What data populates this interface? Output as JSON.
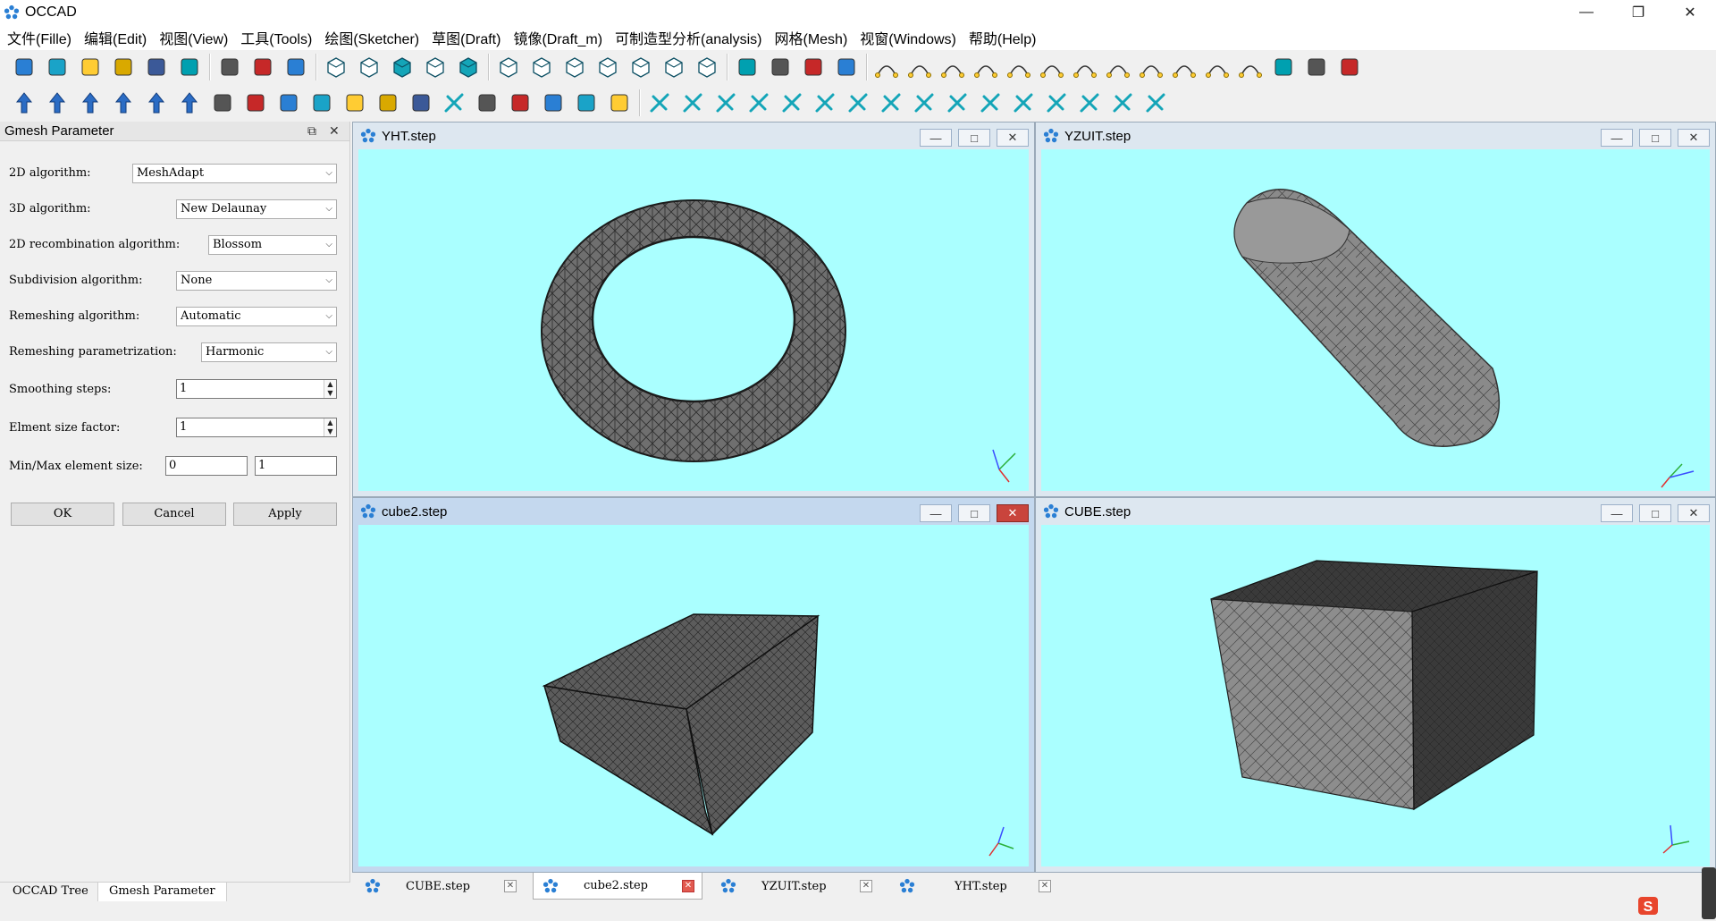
{
  "app": {
    "title": "OCCAD",
    "accent": "#2a7fd4",
    "viewport_bg": "#aaffff"
  },
  "menu": [
    "文件(Fille)",
    "编辑(Edit)",
    "视图(View)",
    "工具(Tools)",
    "绘图(Sketcher)",
    "草图(Draft)",
    "镜像(Draft_m)",
    "可制造型分析(analysis)",
    "网格(Mesh)",
    "视窗(Windows)",
    "帮助(Help)"
  ],
  "toolbar1_icons": [
    "new-file-icon",
    "open-file-icon",
    "save-icon",
    "cut-icon",
    "copy-icon",
    "paste-icon",
    "zoom-fit-icon",
    "zoom-icon",
    "no-select-icon",
    "shaded-view-icon",
    "wireframe-view-icon",
    "hidden-line-icon",
    "points-view-icon",
    "solid-cube-icon",
    "view-front-icon",
    "view-top-icon",
    "view-right-icon",
    "view-left-icon",
    "view-iso-icon",
    "view-back-icon",
    "view-bottom-icon",
    "ruler-icon",
    "pointer-icon",
    "palette-icon",
    "screenshot-icon",
    "line-icon",
    "polyline-icon",
    "circle-icon",
    "arc-icon",
    "spline-icon",
    "polygon-icon",
    "rectangle-icon",
    "text-icon",
    "dimension-icon",
    "bezier-icon",
    "point-icon",
    "s-curve-icon",
    "extrude-icon",
    "hatch-icon",
    "clipboard-tool-icon"
  ],
  "toolbar2_icons": [
    "move-icon",
    "rotate-icon",
    "offset-icon",
    "mirror-h-icon",
    "arrow-up-icon",
    "arrow-down-icon",
    "scale-icon",
    "stretch-icon",
    "trim-icon",
    "split-icon",
    "join-icon",
    "layer-icon",
    "array-icon",
    "grid-array-icon",
    "path-array-icon",
    "visibility-icon",
    "export-icon",
    "symmetry-icon",
    "shape-icon",
    "snap-grid-icon",
    "lock-icon",
    "snap-endpoint-icon",
    "snap-midpoint-icon",
    "snap-parallel-icon",
    "snap-grid2-icon",
    "snap-near-icon",
    "snap-perpendicular-icon",
    "snap-tangent-icon",
    "snap-special-icon",
    "snap-center-icon",
    "snap-ortho-icon",
    "snap-intersection-icon",
    "snap-extension-icon",
    "snap-working-plane-icon",
    "snap-dimension-icon"
  ],
  "dock": {
    "title": "Gmesh Parameter",
    "labels": {
      "alg2d": "2D algorithm:",
      "alg3d": "3D algorithm:",
      "recomb": "2D recombination algorithm:",
      "subdiv": "Subdivision algorithm:",
      "remesh": "Remeshing algorithm:",
      "remesh_param": "Remeshing parametrization:",
      "smoothing": "Smoothing steps:",
      "size_factor": "Elment size factor:",
      "minmax": "Min/Max element size:"
    },
    "values": {
      "alg2d": "MeshAdapt",
      "alg3d": "New Delaunay",
      "recomb": "Blossom",
      "subdiv": "None",
      "remesh": "Automatic",
      "remesh_param": "Harmonic",
      "smoothing": "1",
      "size_factor": "1",
      "min": "0",
      "max": "1"
    },
    "buttons": {
      "ok": "OK",
      "cancel": "Cancel",
      "apply": "Apply"
    },
    "tabs": {
      "tree": "OCCAD Tree",
      "gmesh": "Gmesh Parameter"
    }
  },
  "windows": [
    {
      "title": "YHT.step",
      "shape": "torus"
    },
    {
      "title": "YZUIT.step",
      "shape": "cylinder"
    },
    {
      "title": "cube2.step",
      "shape": "cuboid",
      "active": true
    },
    {
      "title": "CUBE.step",
      "shape": "cube"
    }
  ],
  "doc_tabs": [
    {
      "label": "CUBE.step"
    },
    {
      "label": "cube2.step",
      "active": true
    },
    {
      "label": "YZUIT.step"
    },
    {
      "label": "YHT.step"
    }
  ]
}
